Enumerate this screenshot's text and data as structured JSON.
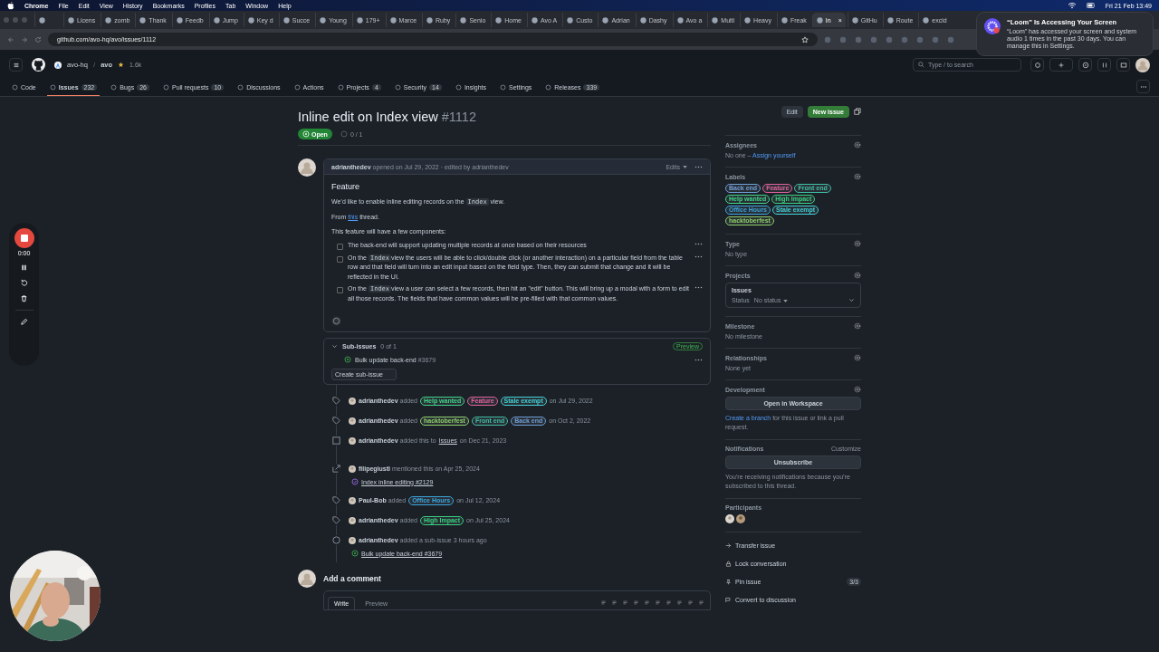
{
  "menubar": {
    "app": "Chrome",
    "items": [
      "File",
      "Edit",
      "View",
      "History",
      "Bookmarks",
      "Profiles",
      "Tab",
      "Window",
      "Help"
    ],
    "clock": "Fri 21 Feb  13:49"
  },
  "browser_tabs": [
    {
      "selected": false
    },
    {
      "label": "Licens",
      "selected": false
    },
    {
      "label": "zomb",
      "selected": false
    },
    {
      "label": "Thank",
      "selected": false
    },
    {
      "label": "Feedb",
      "selected": false
    },
    {
      "label": "Jump",
      "selected": false
    },
    {
      "label": "Key d",
      "selected": false
    },
    {
      "label": "Succe",
      "selected": false
    },
    {
      "label": "Young",
      "selected": false
    },
    {
      "label": "179+",
      "selected": false
    },
    {
      "label": "Marce",
      "selected": false
    },
    {
      "label": "Ruby",
      "selected": false
    },
    {
      "label": "Senio",
      "selected": false
    },
    {
      "label": "Home",
      "selected": false
    },
    {
      "label": "Avo A",
      "selected": false
    },
    {
      "label": "Custo",
      "selected": false
    },
    {
      "label": "Adrian",
      "selected": false
    },
    {
      "label": "Dashy",
      "selected": false
    },
    {
      "label": "Avo a",
      "selected": false
    },
    {
      "label": "Multi",
      "selected": false
    },
    {
      "label": "Heavy",
      "selected": false
    },
    {
      "label": "Freak",
      "selected": false
    },
    {
      "label": "In",
      "selected": true,
      "close": "×"
    },
    {
      "label": "GitHu",
      "selected": false
    },
    {
      "label": "Route",
      "selected": false
    },
    {
      "label": "excid",
      "selected": false
    }
  ],
  "address": "github.com/avo-hq/avo/issues/1112",
  "notification": {
    "title": "“Loom” Is Accessing Your Screen",
    "body": "“Loom” has accessed your screen and system audio 1 times in the past 30 days. You can manage this in Settings."
  },
  "repo": {
    "owner": "avo-hq",
    "separator": "/",
    "name": "avo",
    "stars": "1.6k"
  },
  "search": {
    "placeholder": "Type / to search"
  },
  "repo_tabs": [
    {
      "label": "Code",
      "selected": false
    },
    {
      "label": "Issues",
      "count": "232",
      "selected": true
    },
    {
      "label": "Bugs",
      "count": "26",
      "selected": false
    },
    {
      "label": "Pull requests",
      "count": "10",
      "selected": false
    },
    {
      "label": "Discussions",
      "selected": false
    },
    {
      "label": "Actions",
      "selected": false
    },
    {
      "label": "Projects",
      "count": "4",
      "selected": false
    },
    {
      "label": "Security",
      "count": "14",
      "selected": false
    },
    {
      "label": "Insights",
      "selected": false
    },
    {
      "label": "Settings",
      "selected": false
    },
    {
      "label": "Releases",
      "count": "339",
      "selected": false
    }
  ],
  "issue": {
    "title": "Inline edit on Index view",
    "number": "#1112",
    "state": "Open",
    "sub_count": "0 / 1",
    "edit": "Edit",
    "new": "New issue"
  },
  "comment": {
    "author": "adrianthedev",
    "meta": "opened on Jul 29, 2022 · edited by adrianthedev",
    "edits": "Edits",
    "heading": "Feature",
    "intro": {
      "before": "We’d like to enable inline editing records on the",
      "code": "Index",
      "after": "view."
    },
    "from": {
      "before": "From",
      "link": "this",
      "after": "thread."
    },
    "lead": "This feature will have a few components:",
    "tasks": [
      {
        "checked": false,
        "text": "The back-end will support updating multiple records at once based on their resources"
      },
      {
        "checked": false,
        "before": "On the",
        "code": "Index",
        "text": "view the users will be able to click/double click (or another interaction) on a particular field from the table row and that field will turn into an edit input based on the field type. Then, they can submit that change and it will be reflected in the UI."
      },
      {
        "checked": false,
        "before": "On the",
        "code": "Index",
        "text": "view a user can select a few records, then hit an \"edit\" button. This will bring up a modal with a form to edit all those records. The fields that have common values will be pre-filled with that common values."
      }
    ]
  },
  "sub_issues": {
    "title": "Sub-issues",
    "count": "0 of 1",
    "badge": "Preview",
    "items": [
      {
        "title": "Bulk update back-end",
        "number": "#3679"
      }
    ],
    "create": "Create sub-issue"
  },
  "timeline": [
    {
      "kind": "labeled",
      "author": "adrianthedev",
      "verb": "added",
      "labels": [
        {
          "name": "Help wanted",
          "color": "#3fd68a"
        },
        {
          "name": "Feature",
          "color": "#e3629f"
        },
        {
          "name": "Stale exempt",
          "color": "#3fd3d8"
        }
      ],
      "date": "on Jul 29, 2022"
    },
    {
      "kind": "labeled",
      "author": "adrianthedev",
      "verb": "added",
      "labels": [
        {
          "name": "hacktoberfest",
          "color": "#8fd16a"
        },
        {
          "name": "Front end",
          "color": "#3fbfa5"
        },
        {
          "name": "Back end",
          "color": "#6f9fd8"
        }
      ],
      "date": "on Oct 2, 2022"
    },
    {
      "kind": "project",
      "author": "adrianthedev",
      "verb": "added this to",
      "project": "Issues",
      "date": "on Dec 21, 2023"
    },
    {
      "kind": "mention",
      "author": "filipegiusti",
      "verb": "mentioned this on Apr 25, 2024",
      "link": "Index inline editing #2129",
      "closed": true
    },
    {
      "kind": "labeled",
      "author": "Paul-Bob",
      "verb": "added",
      "labels": [
        {
          "name": "Office Hours",
          "color": "#3aa6e0"
        }
      ],
      "date": "on Jul 12, 2024"
    },
    {
      "kind": "labeled",
      "author": "adrianthedev",
      "verb": "added",
      "labels": [
        {
          "name": "High Impact",
          "color": "#35d07f"
        }
      ],
      "date": "on Jul 25, 2024"
    },
    {
      "kind": "subissue",
      "author": "adrianthedev",
      "verb": "added a sub-issue 3 hours ago",
      "link": "Bulk update back-end #3679",
      "closed": false
    }
  ],
  "new_comment": {
    "title": "Add a comment",
    "tabs": [
      {
        "label": "Write",
        "selected": true
      },
      {
        "label": "Preview",
        "selected": false
      }
    ]
  },
  "sidebar": {
    "assignees": {
      "title": "Assignees",
      "value": "No one –",
      "link": "Assign yourself"
    },
    "labels": {
      "title": "Labels",
      "items": [
        {
          "name": "Back end",
          "color": "#6f9fd8"
        },
        {
          "name": "Feature",
          "color": "#e3629f"
        },
        {
          "name": "Front end",
          "color": "#3fbfa5"
        },
        {
          "name": "Help wanted",
          "color": "#3fd68a"
        },
        {
          "name": "High Impact",
          "color": "#35d07f"
        },
        {
          "name": "Office Hours",
          "color": "#3aa6e0"
        },
        {
          "name": "Stale exempt",
          "color": "#3fd3d8"
        },
        {
          "name": "hacktoberfest",
          "color": "#8fd16a"
        }
      ]
    },
    "type": {
      "title": "Type",
      "value": "No type"
    },
    "projects": {
      "title": "Projects",
      "project": "Issues",
      "status_label": "Status",
      "status": "No status"
    },
    "milestone": {
      "title": "Milestone",
      "value": "No milestone"
    },
    "relationships": {
      "title": "Relationships",
      "value": "None yet"
    },
    "development": {
      "title": "Development",
      "button": "Open in Workspace",
      "link": "Create a branch",
      "text": "for this issue or link a pull request."
    },
    "notifications": {
      "title": "Notifications",
      "customize": "Customize",
      "button": "Unsubscribe",
      "note": "You’re receiving notifications because you’re subscribed to this thread."
    },
    "participants": {
      "title": "Participants"
    },
    "actions": [
      {
        "kind": "transfer",
        "label": "Transfer issue"
      },
      {
        "kind": "lock",
        "label": "Lock conversation"
      },
      {
        "kind": "pin",
        "label": "Pin issue",
        "badge": "3/3"
      },
      {
        "kind": "convert",
        "label": "Convert to discussion"
      }
    ]
  },
  "recorder": {
    "time": "0:00"
  }
}
